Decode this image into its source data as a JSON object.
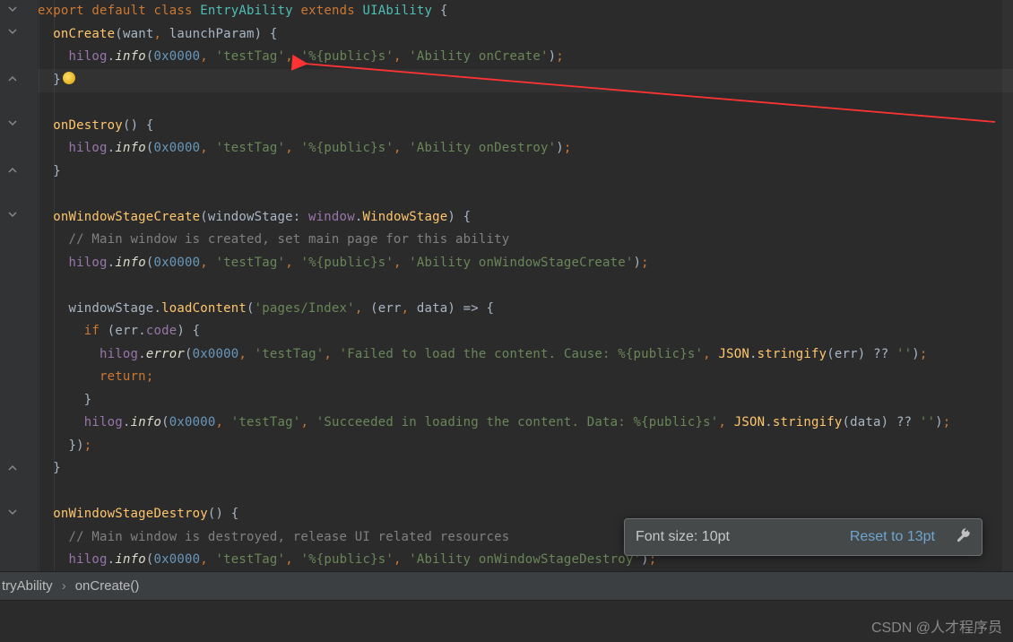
{
  "breadcrumb": {
    "item1": "tryAbility",
    "item2": "onCreate()"
  },
  "fontsize_popup": {
    "label": "Font size: 10pt",
    "reset": "Reset to 13pt"
  },
  "watermark": "CSDN @人才程序员",
  "tokens": {
    "export": "export",
    "default": "default",
    "class": "class",
    "extends": "extends",
    "EntryAbility": "EntryAbility",
    "UIAbility": "UIAbility",
    "onCreate": "onCreate",
    "want": "want",
    "launchParam": "launchParam",
    "hilog": "hilog",
    "info": "info",
    "error": "error",
    "hex0": "0x0000",
    "testTag": "'testTag'",
    "publics": "'%{public}s'",
    "abilityOnCreate": "'Ability onCreate'",
    "onDestroy": "onDestroy",
    "abilityOnDestroy": "'Ability onDestroy'",
    "onWindowStageCreate": "onWindowStageCreate",
    "windowStage": "windowStage",
    "window": "window",
    "WindowStage": "WindowStage",
    "comment_main_create": "// Main window is created, set main page for this ability",
    "abilityOnWSCreate": "'Ability onWindowStageCreate'",
    "loadContent": "loadContent",
    "pagesIndex": "'pages/Index'",
    "err": "err",
    "data": "data",
    "if": "if",
    "code": "code",
    "failedLoad": "'Failed to load the content. Cause: %{public}s'",
    "JSON": "JSON",
    "stringify": "stringify",
    "nullcoal": " ?? ",
    "emptystr": "''",
    "return": "return",
    "succeeded": "'Succeeded in loading the content. Data: %{public}s'",
    "onWindowStageDestroy": "onWindowStageDestroy",
    "comment_main_destroy": "// Main window is destroyed, release UI related resources",
    "abilityOnWSDestroy": "'Ability onWindowStageDestroy'"
  }
}
